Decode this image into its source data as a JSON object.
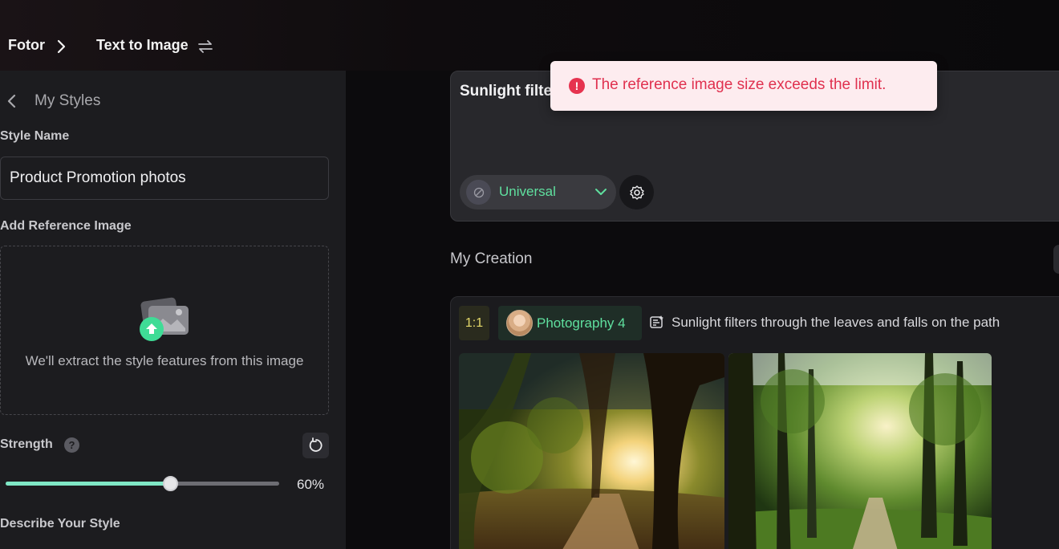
{
  "breadcrumb": {
    "root": "Fotor",
    "current": "Text to Image"
  },
  "sidebar": {
    "title": "My Styles",
    "style_name_label": "Style Name",
    "style_name_value": "Product Promotion photos",
    "reference_label": "Add Reference Image",
    "reference_hint": "We'll extract the style features from this image",
    "strength_label": "Strength",
    "strength_value": "60%",
    "strength_fraction": 0.6,
    "describe_label": "Describe Your Style"
  },
  "prompt": {
    "text": "Sunlight filters through the leaves and falls on the path",
    "model": "Universal"
  },
  "toast": {
    "message": "The reference image size exceeds the limit."
  },
  "creation": {
    "section_title": "My Creation",
    "ratio": "1:1",
    "model": "Photography 4",
    "prompt": "Sunlight filters through the leaves and falls on the path"
  },
  "colors": {
    "accent_green": "#5fe09f",
    "slider_fill": "#7fe7c5",
    "error_red": "#e0314f"
  },
  "icons": [
    "chevron-right-icon",
    "swap-icon",
    "chevron-left-icon",
    "upload-image-icon",
    "help-icon",
    "reset-icon",
    "chevron-down-icon",
    "settings-icon",
    "error-icon",
    "prompt-list-icon"
  ]
}
